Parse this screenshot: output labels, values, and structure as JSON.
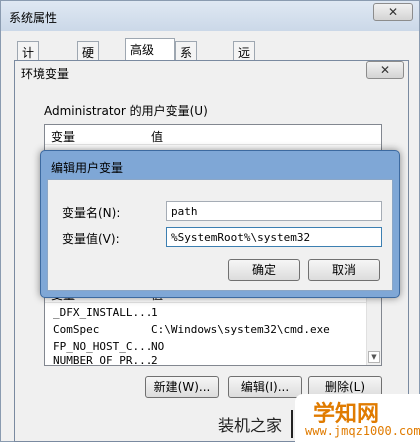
{
  "system_properties": {
    "title": "系统属性",
    "close_glyph": "✕",
    "tabs": [
      "计算机名",
      "硬件",
      "高级",
      "系统保护",
      "远程"
    ],
    "active_tab": 2
  },
  "env_window": {
    "title": "环境变量",
    "close_glyph": "✕",
    "user_group_label": "Administrator 的用户变量(U)",
    "user_list": {
      "col_variable": "变量",
      "col_value": "值"
    },
    "system_list": {
      "col_variable": "变量",
      "col_value": "值",
      "rows": [
        {
          "name": "_DFX_INSTALL...",
          "value": "1"
        },
        {
          "name": "ComSpec",
          "value": "C:\\Windows\\system32\\cmd.exe"
        },
        {
          "name": "FP_NO_HOST_C...",
          "value": "NO"
        },
        {
          "name": "NUMBER_OF_PR...",
          "value": "2"
        }
      ]
    },
    "buttons": {
      "new": "新建(W)...",
      "edit": "编辑(I)...",
      "delete": "删除(L)"
    }
  },
  "edit_dialog": {
    "title": "编辑用户变量",
    "name_label": "变量名(N):",
    "name_value": "path",
    "value_label": "变量值(V):",
    "value_value": "%SystemRoot%\\system32",
    "ok_label": "确定",
    "cancel_label": "取消"
  },
  "watermark": {
    "site_text": "装机之家",
    "logo_main": "学知网",
    "logo_sub": "www.jmqz1000.com"
  },
  "colors": {
    "dialog_frame": "#7fa7d6",
    "watermark_accent": "#e07b00"
  }
}
